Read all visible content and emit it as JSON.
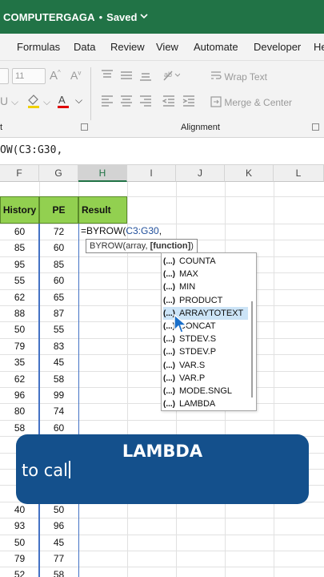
{
  "titlebar": {
    "app": "COMPUTERGAGA",
    "separator": "•",
    "status": "Saved",
    "chevron": "⌵"
  },
  "tabs": [
    "Formulas",
    "Data",
    "Review",
    "View",
    "Automate",
    "Developer",
    "He"
  ],
  "ribbon": {
    "font_size": "11",
    "wrap_text": "Wrap Text",
    "merge_center": "Merge & Center",
    "group_font_tail": "t",
    "group_alignment": "Alignment"
  },
  "formula_bar": {
    "text": "OW(C3:G30,"
  },
  "columns": [
    "F",
    "G",
    "H",
    "I",
    "J",
    "K",
    "L"
  ],
  "headers": {
    "f": "History",
    "g": "PE",
    "h": "Result"
  },
  "rows": [
    {
      "f": "60",
      "g": "72"
    },
    {
      "f": "85",
      "g": "60"
    },
    {
      "f": "95",
      "g": "85"
    },
    {
      "f": "55",
      "g": "60"
    },
    {
      "f": "62",
      "g": "65"
    },
    {
      "f": "88",
      "g": "87"
    },
    {
      "f": "50",
      "g": "55"
    },
    {
      "f": "79",
      "g": "83"
    },
    {
      "f": "35",
      "g": "45"
    },
    {
      "f": "62",
      "g": "58"
    },
    {
      "f": "96",
      "g": "99"
    },
    {
      "f": "80",
      "g": "74"
    },
    {
      "f": "58",
      "g": "60"
    },
    {
      "f": "",
      "g": ""
    },
    {
      "f": "",
      "g": ""
    },
    {
      "f": "",
      "g": ""
    },
    {
      "f": "",
      "g": ""
    },
    {
      "f": "40",
      "g": "50"
    },
    {
      "f": "93",
      "g": "96"
    },
    {
      "f": "50",
      "g": "45"
    },
    {
      "f": "79",
      "g": "77"
    },
    {
      "f": "52",
      "g": "58"
    }
  ],
  "cell_formula": {
    "prefix": "=BYROW(",
    "ref": "C3:G30",
    "suffix": ","
  },
  "tooltip": {
    "text": "BYROW(array, ",
    "bold": "[function]",
    "end": ")"
  },
  "autocomplete": {
    "fx_glyph": "(...)",
    "items": [
      "COUNTA",
      "MAX",
      "MIN",
      "PRODUCT",
      "ARRAYTOTEXT",
      "CONCAT",
      "STDEV.S",
      "STDEV.P",
      "VAR.S",
      "VAR.P",
      "MODE.SNGL",
      "LAMBDA"
    ],
    "selected_index": 4
  },
  "caption": {
    "line1": "LAMBDA",
    "line2": "to cal"
  },
  "colors": {
    "excel_green": "#217346",
    "header_green": "#92d050",
    "caption_blue": "#14508c"
  }
}
